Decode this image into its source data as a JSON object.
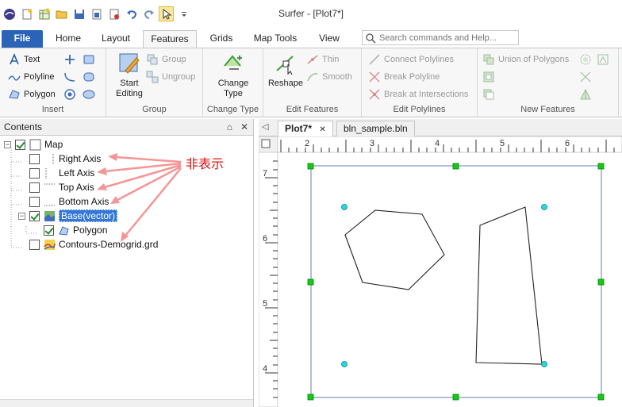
{
  "window": {
    "title": "Surfer - [Plot7*]"
  },
  "quick_access": [
    "app-menu-icon",
    "new-icon",
    "new-worksheet-icon",
    "open-icon",
    "save-icon",
    "export-icon",
    "print-icon",
    "undo-icon",
    "redo-icon",
    "select-icon",
    "customize-icon"
  ],
  "tabs": [
    {
      "label": "File"
    },
    {
      "label": "Home"
    },
    {
      "label": "Layout"
    },
    {
      "label": "Features"
    },
    {
      "label": "Grids"
    },
    {
      "label": "Map Tools"
    },
    {
      "label": "View"
    }
  ],
  "search": {
    "placeholder": "Search commands and Help..."
  },
  "ribbon": {
    "insert": {
      "label": "Insert",
      "text": "Text",
      "polyline": "Polyline",
      "polygon": "Polygon"
    },
    "group": {
      "label": "Group",
      "start_editing": "Start Editing",
      "group": "Group",
      "ungroup": "Ungroup"
    },
    "change_type": {
      "label": "Change Type",
      "button": "Change Type"
    },
    "edit_features": {
      "label": "Edit Features",
      "reshape": "Reshape",
      "thin": "Thin",
      "smooth": "Smooth"
    },
    "edit_polylines": {
      "label": "Edit Polylines",
      "connect": "Connect Polylines",
      "break": "Break Polyline",
      "break_intersections": "Break at Intersections"
    },
    "new_features": {
      "label": "New Features",
      "union": "Union of Polygons"
    }
  },
  "contents": {
    "title": "Contents",
    "pin": "⌂",
    "close": "✕",
    "items": [
      {
        "label": "Map",
        "checked": true
      },
      {
        "label": "Right Axis",
        "checked": false
      },
      {
        "label": "Left Axis",
        "checked": false
      },
      {
        "label": "Top Axis",
        "checked": false
      },
      {
        "label": "Bottom Axis",
        "checked": false
      },
      {
        "label": "Base(vector)",
        "checked": true
      },
      {
        "label": "Polygon",
        "checked": true
      },
      {
        "label": "Contours-Demogrid.grd",
        "checked": false
      }
    ],
    "annotation": "非表示"
  },
  "documents": {
    "tabs": [
      {
        "label": "Plot7*"
      },
      {
        "label": "bln_sample.bln"
      }
    ],
    "close_glyph": "✕",
    "h_ruler": [
      "2",
      "3",
      "4",
      "5",
      "6"
    ],
    "v_ruler": [
      "7",
      "6",
      "5",
      "4"
    ]
  },
  "colors": {
    "file_tab": "#2b63b8",
    "selection": "#3478d4",
    "annotation": "#e01010",
    "handle": "#11cc11",
    "vertex": "#26d7e0"
  }
}
